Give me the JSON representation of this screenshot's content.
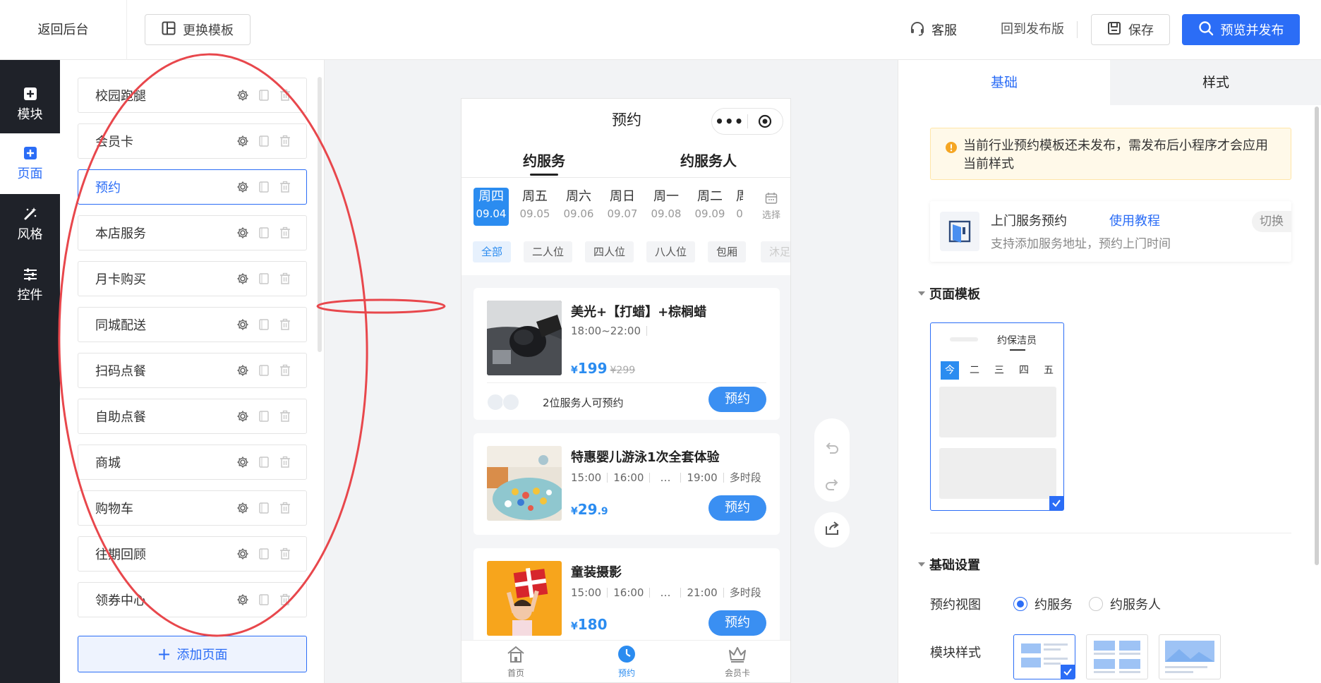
{
  "topbar": {
    "back_label": "返回后台",
    "change_template_label": "更换模板",
    "service_label": "客服",
    "back_to_published_label": "回到发布版",
    "save_label": "保存",
    "preview_publish_label": "预览并发布"
  },
  "leftnav": {
    "items": [
      {
        "label": "模块",
        "icon": "plus-square-icon"
      },
      {
        "label": "页面",
        "icon": "plus-square-icon"
      },
      {
        "label": "风格",
        "icon": "magic-wand-icon"
      },
      {
        "label": "控件",
        "icon": "sliders-icon"
      }
    ],
    "active": "页面"
  },
  "pages": {
    "items": [
      "校园跑腿",
      "会员卡",
      "预约",
      "本店服务",
      "月卡购买",
      "同城配送",
      "扫码点餐",
      "自助点餐",
      "商城",
      "购物车",
      "往期回顾",
      "领券中心"
    ],
    "active": "预约",
    "add_label": "添加页面"
  },
  "phone": {
    "title": "预约",
    "capsule_dots": "•••",
    "tabs": [
      "约服务",
      "约服务人"
    ],
    "dates": [
      {
        "week": "周四",
        "date": "09.04"
      },
      {
        "week": "周五",
        "date": "09.05"
      },
      {
        "week": "周六",
        "date": "09.06"
      },
      {
        "week": "周日",
        "date": "09.07"
      },
      {
        "week": "周一",
        "date": "09.08"
      },
      {
        "week": "周二",
        "date": "09.09"
      },
      {
        "week": "周",
        "date": "0"
      }
    ],
    "date_pick_label": "选择",
    "filters": [
      "全部",
      "二人位",
      "四人位",
      "八人位",
      "包厢",
      "沐足"
    ],
    "cards": [
      {
        "title": "美光+【打蜡】+棕榈蜡",
        "times": [
          "18:00~22:00"
        ],
        "price_symbol": "¥",
        "price": "199",
        "price_decimal": "",
        "old_price": "¥299",
        "staff_text": "2位服务人可预约",
        "button": "预约"
      },
      {
        "title": "特惠婴儿游泳1次全套体验",
        "times": [
          "15:00",
          "16:00",
          "…",
          "19:00",
          "多时段"
        ],
        "price_symbol": "¥",
        "price": "29",
        "price_decimal": ".9",
        "old_price": "",
        "button": "预约"
      },
      {
        "title": "童装摄影",
        "times": [
          "15:00",
          "16:00",
          "…",
          "21:00",
          "多时段"
        ],
        "price_symbol": "¥",
        "price": "180",
        "price_decimal": "",
        "old_price": "",
        "button": "预约"
      }
    ],
    "tabbar": [
      {
        "label": "首页",
        "icon": "home-icon"
      },
      {
        "label": "预约",
        "icon": "clock-icon"
      },
      {
        "label": "会员卡",
        "icon": "crown-icon"
      }
    ]
  },
  "right": {
    "tabs": [
      "基础",
      "样式"
    ],
    "notice": "当前行业预约模板还未发布，需发布后小程序才会应用当前样式",
    "template": {
      "name": "上门服务预约",
      "tutorial": "使用教程",
      "desc": "支持添加服务地址，预约上门时间",
      "switch": "切换"
    },
    "page_template_title": "页面模板",
    "thumb": {
      "title": "约保洁员",
      "days": [
        "今",
        "二",
        "三",
        "四",
        "五"
      ]
    },
    "basic_settings_title": "基础设置",
    "view_label": "预约视图",
    "view_options": [
      "约服务",
      "约服务人"
    ],
    "view_selected": "约服务",
    "module_style_label": "模块样式"
  },
  "colors": {
    "primary": "#2b6df6",
    "phone_accent": "#2b8cf0",
    "dark_nav": "#1f2229",
    "annotation": "#e8474c"
  }
}
